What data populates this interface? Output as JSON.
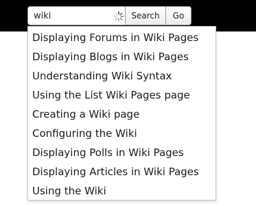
{
  "search": {
    "value": "wiki",
    "button_label": "Search",
    "go_label": "Go",
    "loading_icon": "spinner-icon"
  },
  "suggestions": [
    "Displaying Forums in Wiki Pages",
    "Displaying Blogs in Wiki Pages",
    "Understanding Wiki Syntax",
    "Using the List Wiki Pages page",
    "Creating a Wiki page",
    "Configuring the Wiki",
    "Displaying Polls in Wiki Pages",
    "Displaying Articles in Wiki Pages",
    "Using the Wiki"
  ],
  "colors": {
    "header_background": "#000000",
    "dropdown_border": "#c6c6c6",
    "text": "#1a1a1a"
  }
}
